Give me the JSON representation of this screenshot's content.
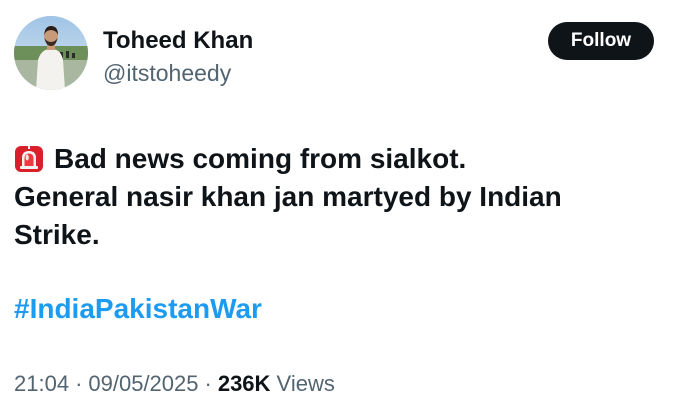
{
  "author": {
    "display_name": "Toheed Khan",
    "handle": "@itstoheedy"
  },
  "follow_button": {
    "label": "Follow"
  },
  "tweet": {
    "siren_icon": "rotating-light-emoji-icon",
    "lines": [
      "Bad news coming from sialkot.",
      "General nasir khan jan martyed by Indian",
      "Strike."
    ],
    "hashtag": "#IndiaPakistanWar"
  },
  "meta": {
    "time": "21:04",
    "separator": "·",
    "date": "09/05/2025",
    "views_count": "236K",
    "views_label": "Views"
  },
  "colors": {
    "text": "#0f1419",
    "secondary": "#536471",
    "link": "#1d9bf0",
    "button_bg": "#0f1419",
    "button_text": "#ffffff"
  }
}
